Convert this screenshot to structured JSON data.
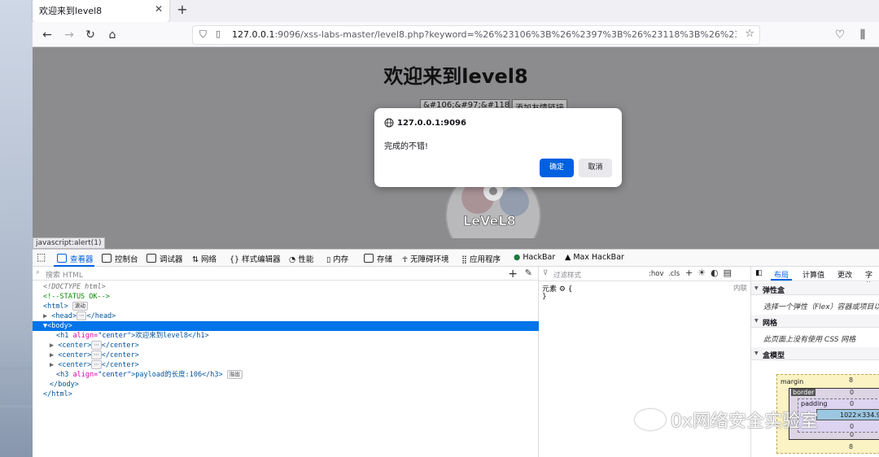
{
  "browser": {
    "tab_title": "欢迎来到level8",
    "url_host": "127.0.0.1",
    "url_rest": ":9096/xss-labs-master/level8.php?keyword=%26%23106%3B%26%2397%3B%26%23118%3B%26%2397%3B%26%231",
    "status_url": "javascript:alert(1)"
  },
  "page": {
    "title": "欢迎来到level8",
    "keyword_value": "&#106;&#97;&#118;&",
    "add_button": "添加友情链接"
  },
  "dialog": {
    "host": "127.0.0.1:9096",
    "message": "完成的不错!",
    "ok_label": "确定",
    "cancel_label": "取消"
  },
  "devtools": {
    "tabs": [
      "查看器",
      "控制台",
      "调试器",
      "网络",
      "样式编辑器",
      "性能",
      "内存",
      "存储",
      "无障碍环境",
      "应用程序",
      "HackBar",
      "Max HackBar"
    ],
    "search_placeholder": "搜索 HTML",
    "tree": {
      "doctype": "<!DOCTYPE html>",
      "comment": "<!--STATUS OK-->",
      "html_open": "<html>",
      "badge_scroll": "滚动",
      "head_open": "<head>",
      "head_close": "</head>",
      "body_open": "<body>",
      "h1_tag": "<h1",
      "h1_attr": "align=",
      "h1_val": "\"center\"",
      "h1_text": ">欢迎来到level8</h1>",
      "center_open": "<center>",
      "center_close": "</center>",
      "h3_tag": "<h3",
      "h3_attr": "align=",
      "h3_val": "\"center\"",
      "h3_text": ">payload的长度:106</h3>",
      "badge_overflow": "溢出",
      "body_close": "</body>",
      "html_close": "</html>",
      "ellipsis": "⋯"
    },
    "rules": {
      "filter_placeholder": "过滤样式",
      "hov": ":hov",
      "cls": ".cls",
      "element_rule": "元素 ⚙ {",
      "element_close": "}",
      "inline": "内联"
    },
    "layout": {
      "tabs": [
        "布局",
        "计算值",
        "更改",
        "字体"
      ],
      "flex_title": "弹性盒",
      "flex_desc": "选择一个弹性（Flex）容器或项目以",
      "grid_title": "网格",
      "grid_desc": "此页面上没有使用 CSS 网格",
      "box_title": "盒模型",
      "margin_label": "margin",
      "border_label": "border",
      "padding_label": "padding",
      "margin_value": "8",
      "zero": "0",
      "content_size": "1022×334.95"
    }
  },
  "watermark": "0x网络安全实验室"
}
